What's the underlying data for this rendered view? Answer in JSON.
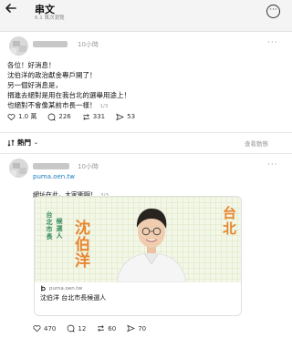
{
  "header": {
    "back_icon": "arrow-left-icon",
    "title": "串文",
    "subtitle": "6.1 萬次瀏覽",
    "more_icon": "more-circle-icon"
  },
  "post": {
    "time": "10小時",
    "menu": "···",
    "lines": [
      "各位！好消息！",
      "沈伯洋的政治獻金專戶開了！",
      "另一個好消息是，",
      "捐進去絕對是用在我台北的選舉用途上！",
      "也絕對不會像某前市長一樣！"
    ],
    "page": "1/3",
    "stats": {
      "likes": "1.0 萬",
      "comments": "226",
      "reposts": "331",
      "shares": "53"
    }
  },
  "sort_bar": {
    "label": "熱門",
    "view_activity": "查看動態"
  },
  "reply": {
    "time": "10小時",
    "menu": "···",
    "link": "puma.oen.tw",
    "text": "網址在此，大家衝啊！",
    "page": "3/3",
    "preview": {
      "poster_name": "沈伯洋",
      "poster_city": "台北",
      "poster_side_1": "台北市長",
      "poster_side_2": "候選人",
      "domain": "puma.oen.tw",
      "title": "沈伯洋 台北市長候選人"
    },
    "stats": {
      "likes": "470",
      "comments": "12",
      "reposts": "60",
      "shares": "70"
    }
  }
}
